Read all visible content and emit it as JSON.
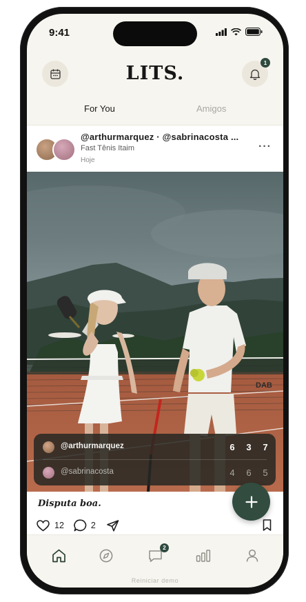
{
  "status_bar": {
    "time": "9:41"
  },
  "header": {
    "logo": "LITS.",
    "notifications_count": "1"
  },
  "tabs": [
    {
      "label": "For You",
      "active": true
    },
    {
      "label": "Amigos",
      "active": false
    }
  ],
  "post": {
    "users": "@arthurmarquez · @sabrinacosta ...",
    "location": "Fast Tênis Itaim",
    "time": "Hoje",
    "caption": "Disputa boa.",
    "likes": "12",
    "comments": "2",
    "score": {
      "rows": [
        {
          "player": "@arthurmarquez",
          "sets": [
            "6",
            "3",
            "7"
          ]
        },
        {
          "player": "@sabrinacosta",
          "sets": [
            "4",
            "6",
            "5"
          ]
        }
      ]
    }
  },
  "bottom_nav": {
    "messages_badge": "2"
  },
  "footer": {
    "link": "Reiniciar demo"
  },
  "colors": {
    "accent": "#324c40",
    "background": "#f6f5ef"
  }
}
